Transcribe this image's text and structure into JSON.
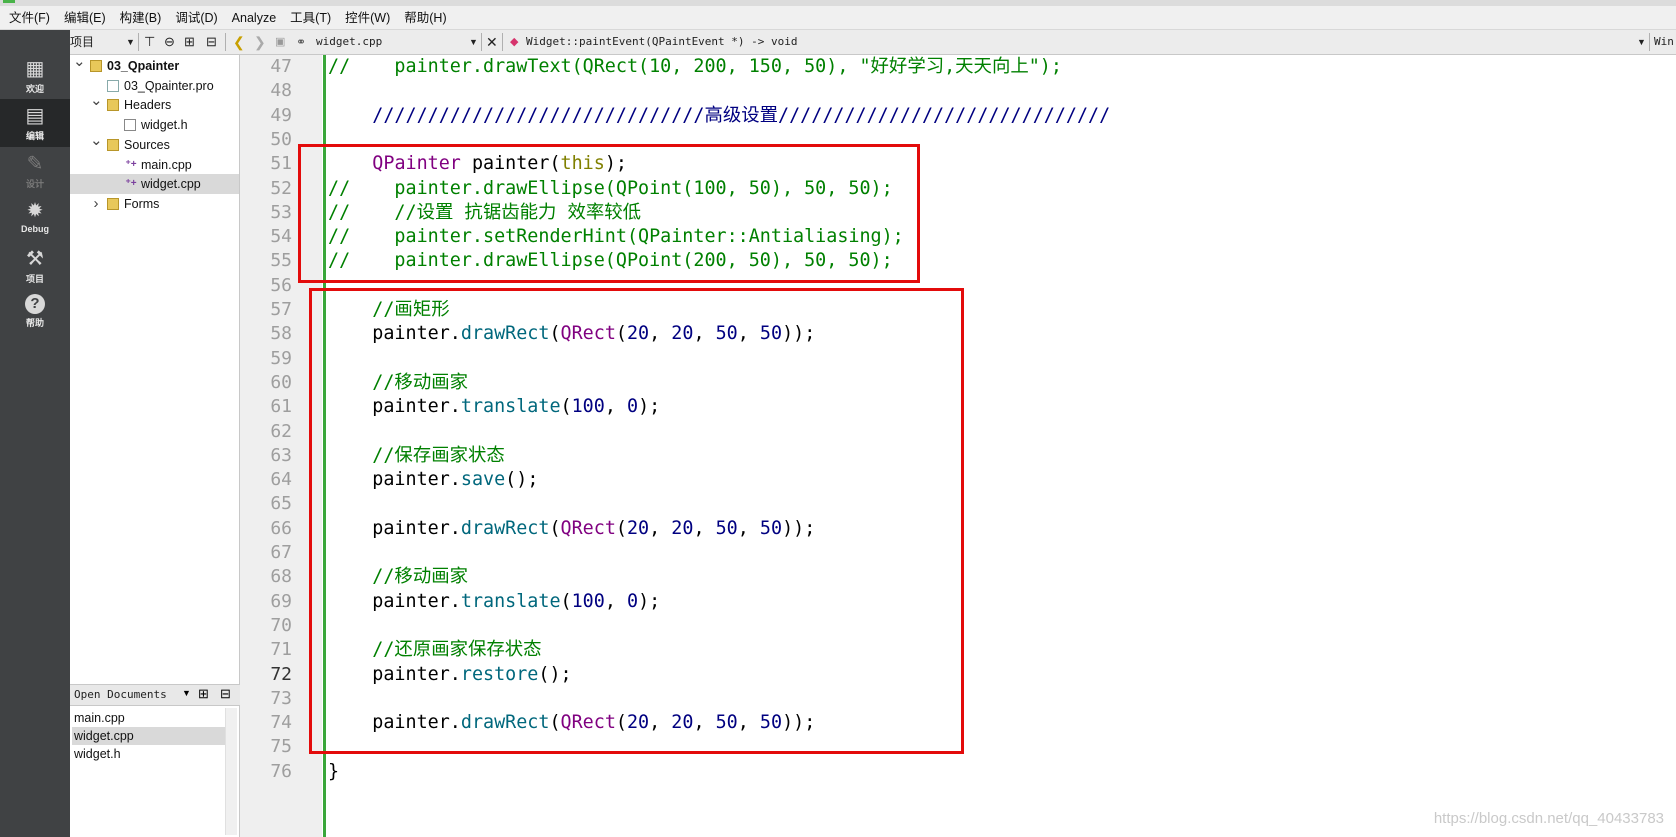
{
  "menu": [
    "文件(F)",
    "编辑(E)",
    "构建(B)",
    "调试(D)",
    "Analyze",
    "工具(T)",
    "控件(W)",
    "帮助(H)"
  ],
  "modes": [
    {
      "label": "欢迎",
      "icon": "grid-icon"
    },
    {
      "label": "编辑",
      "icon": "edit-document-icon"
    },
    {
      "label": "设计",
      "icon": "pencil-icon"
    },
    {
      "label": "Debug",
      "icon": "bug-icon"
    },
    {
      "label": "项目",
      "icon": "wrench-icon"
    },
    {
      "label": "帮助",
      "icon": "help-icon"
    }
  ],
  "toolbar": {
    "project_selector": "项目",
    "file_name": "widget.cpp",
    "function_name": "Widget::paintEvent(QPaintEvent *) -> void",
    "right_text": "Win"
  },
  "project_tree": [
    {
      "label": "03_Qpainter",
      "bold": true,
      "level": 0,
      "expanded": true,
      "icon": "project-folder-icon"
    },
    {
      "label": "03_Qpainter.pro",
      "level": 1,
      "icon": "pro-file-icon"
    },
    {
      "label": "Headers",
      "level": 1,
      "expanded": true,
      "icon": "headers-folder-icon"
    },
    {
      "label": "widget.h",
      "level": 2,
      "icon": "header-file-icon"
    },
    {
      "label": "Sources",
      "level": 1,
      "expanded": true,
      "icon": "sources-folder-icon"
    },
    {
      "label": "main.cpp",
      "level": 2,
      "icon": "cpp-file-icon"
    },
    {
      "label": "widget.cpp",
      "level": 2,
      "icon": "cpp-file-icon",
      "selected": true
    },
    {
      "label": "Forms",
      "level": 1,
      "expanded": false,
      "icon": "forms-folder-icon"
    }
  ],
  "open_documents": {
    "title": "Open Documents",
    "items": [
      "main.cpp",
      "widget.cpp",
      "widget.h"
    ],
    "selected": "widget.cpp"
  },
  "editor": {
    "current_line": "72",
    "lines": [
      {
        "n": "47",
        "tokens": [
          [
            "cm",
            "//    painter.drawText(QRect(10, 200, 150, 50), \"好好学习,天天向上\");"
          ]
        ]
      },
      {
        "n": "48",
        "tokens": []
      },
      {
        "n": "49",
        "tokens": [
          [
            "nm",
            "    //////////////////////////////"
          ],
          [
            "nm",
            "高级设置"
          ],
          [
            "nm",
            "//////////////////////////////"
          ]
        ]
      },
      {
        "n": "50",
        "tokens": []
      },
      {
        "n": "51",
        "tokens": [
          [
            "",
            "    "
          ],
          [
            "ty",
            "QPainter"
          ],
          [
            "",
            " painter("
          ],
          [
            "kw",
            "this"
          ],
          [
            "",
            ");"
          ]
        ]
      },
      {
        "n": "52",
        "tokens": [
          [
            "cm",
            "//    painter.drawEllipse(QPoint(100, 50), 50, 50);"
          ]
        ]
      },
      {
        "n": "53",
        "tokens": [
          [
            "cm",
            "//    //设置 抗锯齿能力 效率较低"
          ]
        ]
      },
      {
        "n": "54",
        "tokens": [
          [
            "cm",
            "//    painter.setRenderHint(QPainter::Antialiasing);"
          ]
        ]
      },
      {
        "n": "55",
        "tokens": [
          [
            "cm",
            "//    painter.drawEllipse(QPoint(200, 50), 50, 50);"
          ]
        ]
      },
      {
        "n": "56",
        "tokens": []
      },
      {
        "n": "57",
        "tokens": [
          [
            "cm",
            "    //画矩形"
          ]
        ]
      },
      {
        "n": "58",
        "tokens": [
          [
            "",
            "    painter."
          ],
          [
            "fn",
            "drawRect"
          ],
          [
            "",
            "("
          ],
          [
            "ty",
            "QRect"
          ],
          [
            "",
            "("
          ],
          [
            "nm",
            "20"
          ],
          [
            "",
            ", "
          ],
          [
            "nm",
            "20"
          ],
          [
            "",
            ", "
          ],
          [
            "nm",
            "50"
          ],
          [
            "",
            ", "
          ],
          [
            "nm",
            "50"
          ],
          [
            "",
            "));"
          ]
        ]
      },
      {
        "n": "59",
        "tokens": []
      },
      {
        "n": "60",
        "tokens": [
          [
            "cm",
            "    //移动画家"
          ]
        ]
      },
      {
        "n": "61",
        "tokens": [
          [
            "",
            "    painter."
          ],
          [
            "fn",
            "translate"
          ],
          [
            "",
            "("
          ],
          [
            "nm",
            "100"
          ],
          [
            "",
            ", "
          ],
          [
            "nm",
            "0"
          ],
          [
            "",
            ");"
          ]
        ]
      },
      {
        "n": "62",
        "tokens": []
      },
      {
        "n": "63",
        "tokens": [
          [
            "cm",
            "    //保存画家状态"
          ]
        ]
      },
      {
        "n": "64",
        "tokens": [
          [
            "",
            "    painter."
          ],
          [
            "fn",
            "save"
          ],
          [
            "",
            "();"
          ]
        ]
      },
      {
        "n": "65",
        "tokens": []
      },
      {
        "n": "66",
        "tokens": [
          [
            "",
            "    painter."
          ],
          [
            "fn",
            "drawRect"
          ],
          [
            "",
            "("
          ],
          [
            "ty",
            "QRect"
          ],
          [
            "",
            "("
          ],
          [
            "nm",
            "20"
          ],
          [
            "",
            ", "
          ],
          [
            "nm",
            "20"
          ],
          [
            "",
            ", "
          ],
          [
            "nm",
            "50"
          ],
          [
            "",
            ", "
          ],
          [
            "nm",
            "50"
          ],
          [
            "",
            "));"
          ]
        ]
      },
      {
        "n": "67",
        "tokens": []
      },
      {
        "n": "68",
        "tokens": [
          [
            "cm",
            "    //移动画家"
          ]
        ]
      },
      {
        "n": "69",
        "tokens": [
          [
            "",
            "    painter."
          ],
          [
            "fn",
            "translate"
          ],
          [
            "",
            "("
          ],
          [
            "nm",
            "100"
          ],
          [
            "",
            ", "
          ],
          [
            "nm",
            "0"
          ],
          [
            "",
            ");"
          ]
        ]
      },
      {
        "n": "70",
        "tokens": []
      },
      {
        "n": "71",
        "tokens": [
          [
            "cm",
            "    //还原画家保存状态"
          ]
        ]
      },
      {
        "n": "72",
        "tokens": [
          [
            "",
            "    painter."
          ],
          [
            "fn",
            "restore"
          ],
          [
            "",
            "();"
          ]
        ]
      },
      {
        "n": "73",
        "tokens": []
      },
      {
        "n": "74",
        "tokens": [
          [
            "",
            "    painter."
          ],
          [
            "fn",
            "drawRect"
          ],
          [
            "",
            "("
          ],
          [
            "ty",
            "QRect"
          ],
          [
            "",
            "("
          ],
          [
            "nm",
            "20"
          ],
          [
            "",
            ", "
          ],
          [
            "nm",
            "20"
          ],
          [
            "",
            ", "
          ],
          [
            "nm",
            "50"
          ],
          [
            "",
            ", "
          ],
          [
            "nm",
            "50"
          ],
          [
            "",
            "));"
          ]
        ]
      },
      {
        "n": "75",
        "tokens": []
      },
      {
        "n": "76",
        "tokens": [
          [
            "",
            "}"
          ]
        ]
      }
    ]
  },
  "colors": {
    "highlight_box": "#e30b0b",
    "comment": "#008000",
    "type": "#800080",
    "keyword": "#808000",
    "function": "#00677c",
    "number": "#000080",
    "fold_bar": "#3aa63a",
    "mode_bar": "#404244"
  },
  "watermark": "https://blog.csdn.net/qq_40433783"
}
